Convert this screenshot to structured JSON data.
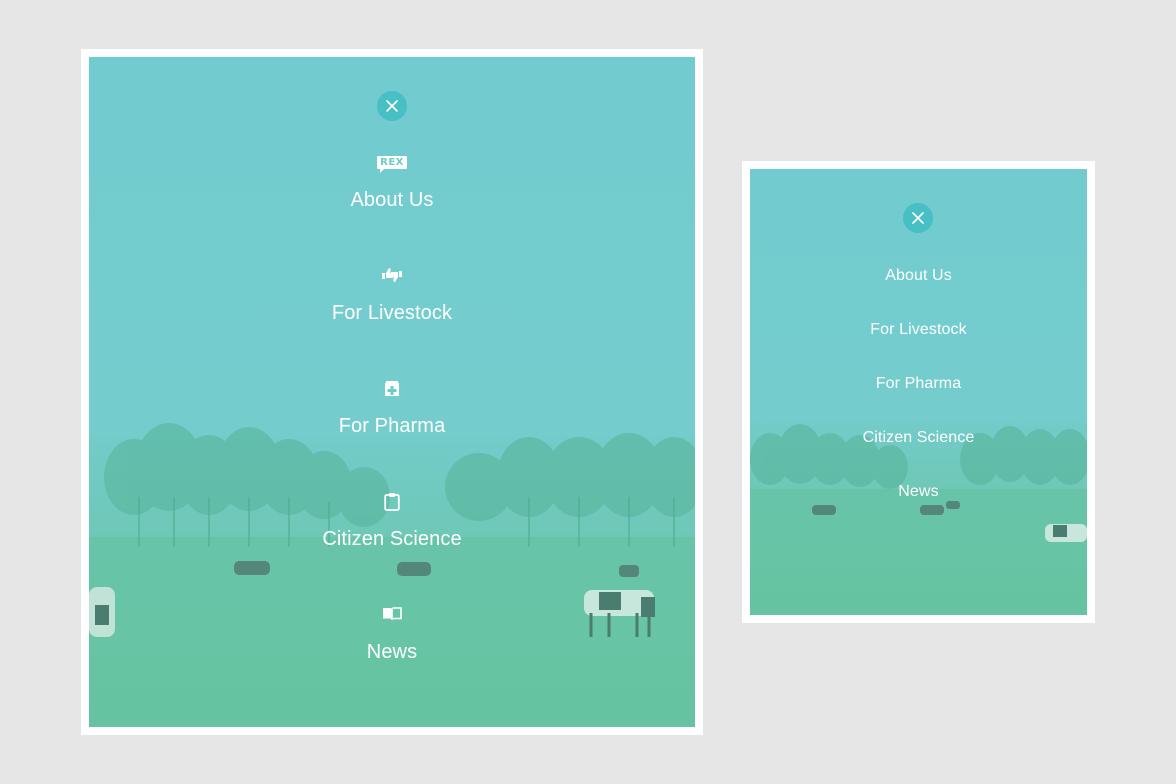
{
  "menu": {
    "close_icon": "close-icon",
    "items": [
      {
        "id": "about-us",
        "label": "About Us",
        "icon": "rex-logo-icon",
        "icon_text": "REX"
      },
      {
        "id": "for-livestock",
        "label": "For Livestock",
        "icon": "thumbs-up-down-icon"
      },
      {
        "id": "for-pharma",
        "label": "For Pharma",
        "icon": "pharmacy-icon"
      },
      {
        "id": "citizen-science",
        "label": "Citizen Science",
        "icon": "clipboard-icon"
      },
      {
        "id": "news",
        "label": "News",
        "icon": "open-book-icon"
      }
    ]
  },
  "colors": {
    "overlay": "#72cbcf",
    "background": "#e6e6e6",
    "frame": "#ffffff",
    "close_button": "#46bec3",
    "text": "#ffffff"
  }
}
